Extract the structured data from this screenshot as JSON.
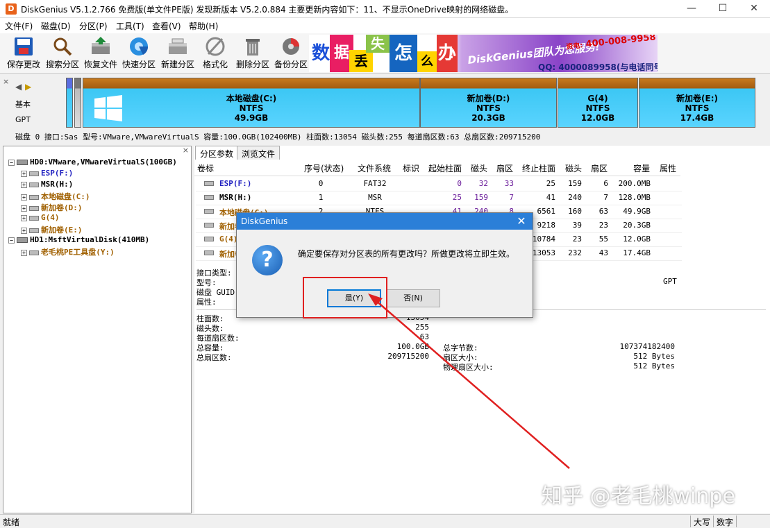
{
  "window": {
    "app_icon": "D",
    "title": "DiskGenius V5.1.2.766 免费版(单文件PE版)  发现新版本 V5.2.0.884 主要更新内容如下：11、不显示OneDrive映射的网络磁盘。",
    "minimize": "—",
    "maximize": "☐",
    "close": "✕"
  },
  "menu": [
    "文件(F)",
    "磁盘(D)",
    "分区(P)",
    "工具(T)",
    "查看(V)",
    "帮助(H)"
  ],
  "toolbar": [
    {
      "label": "保存更改",
      "icon": "save-icon"
    },
    {
      "label": "搜索分区",
      "icon": "magnifier-icon"
    },
    {
      "label": "恢复文件",
      "icon": "recover-icon"
    },
    {
      "label": "快速分区",
      "icon": "quick-partition-icon"
    },
    {
      "label": "新建分区",
      "icon": "new-partition-icon"
    },
    {
      "label": "格式化",
      "icon": "format-icon"
    },
    {
      "label": "删除分区",
      "icon": "trash-icon"
    },
    {
      "label": "备份分区",
      "icon": "backup-icon"
    }
  ],
  "banner": {
    "chars": [
      "数",
      "据",
      "丢",
      "失",
      "怎",
      "么",
      "办",
      "!"
    ],
    "slogan": "DiskGenius团队为您服务!",
    "phone": "400-008-9958",
    "phone_prefix": "资电:",
    "qq": "QQ: 4000089958(与电话同号)"
  },
  "disk_nav": {
    "close": "×",
    "basic": "基本",
    "gpt": "GPT"
  },
  "partitions": [
    {
      "name": "本地磁盘(C:)",
      "fs": "NTFS",
      "size": "49.9GB"
    },
    {
      "name": "新加卷(D:)",
      "fs": "NTFS",
      "size": "20.3GB"
    },
    {
      "name": "G(4)",
      "fs": "NTFS",
      "size": "12.0GB"
    },
    {
      "name": "新加卷(E:)",
      "fs": "NTFS",
      "size": "17.4GB"
    }
  ],
  "disk_info": "磁盘 0 接口:Sas  型号:VMware,VMwareVirtualS  容量:100.0GB(102400MB)  柱面数:13054  磁头数:255  每道扇区数:63  总扇区数:209715200",
  "tree": [
    {
      "label": "HD0:VMware,VMwareVirtualS(100GB)",
      "level": 0,
      "color": "#000000"
    },
    {
      "label": "ESP(F:)",
      "level": 1,
      "color": "#2020c0"
    },
    {
      "label": "MSR(H:)",
      "level": 1,
      "color": "#000000"
    },
    {
      "label": "本地磁盘(C:)",
      "level": 1,
      "color": "#a06000"
    },
    {
      "label": "新加卷(D:)",
      "level": 1,
      "color": "#a06000"
    },
    {
      "label": "G(4)",
      "level": 1,
      "color": "#a06000"
    },
    {
      "label": "新加卷(E:)",
      "level": 1,
      "color": "#a06000"
    },
    {
      "label": "HD1:MsftVirtualDisk(410MB)",
      "level": 0,
      "color": "#000000"
    },
    {
      "label": "老毛桃PE工具盘(Y:)",
      "level": 1,
      "color": "#a06000"
    }
  ],
  "tabs": [
    "分区参数",
    "浏览文件"
  ],
  "table": {
    "headers": [
      "卷标",
      "序号(状态)",
      "文件系统",
      "标识",
      "起始柱面",
      "磁头",
      "扇区",
      "终止柱面",
      "磁头",
      "扇区",
      "容量",
      "属性"
    ],
    "rows": [
      {
        "label": "ESP(F:)",
        "index": "0",
        "fs": "FAT32",
        "sc": "0",
        "sh": "32",
        "ss": "33",
        "ec": "25",
        "eh": "159",
        "es": "6",
        "size": "200.0MB",
        "color": "#2020c0"
      },
      {
        "label": "MSR(H:)",
        "index": "1",
        "fs": "MSR",
        "sc": "25",
        "sh": "159",
        "ss": "7",
        "ec": "41",
        "eh": "240",
        "es": "7",
        "size": "128.0MB",
        "color": "#000000"
      },
      {
        "label": "本地磁盘(C:)",
        "index": "2",
        "fs": "NTFS",
        "sc": "41",
        "sh": "240",
        "ss": "8",
        "ec": "6561",
        "eh": "160",
        "es": "63",
        "size": "49.9GB",
        "color": "#a06000"
      },
      {
        "label": "新加卷(D:)",
        "index": "",
        "fs": "",
        "sc": "",
        "sh": "",
        "ss": "",
        "ec": "9218",
        "eh": "39",
        "es": "23",
        "size": "20.3GB",
        "color": "#a06000"
      },
      {
        "label": "G(4)",
        "index": "",
        "fs": "",
        "sc": "",
        "sh": "",
        "ss": "",
        "ec": "10784",
        "eh": "23",
        "es": "55",
        "size": "12.0GB",
        "color": "#a06000"
      },
      {
        "label": "新加卷(E:)",
        "index": "",
        "fs": "",
        "sc": "",
        "sh": "",
        "ss": "",
        "ec": "13053",
        "eh": "232",
        "es": "43",
        "size": "17.4GB",
        "color": "#a06000"
      }
    ]
  },
  "details": {
    "interface_label": "接口类型:",
    "model_label": "型号:",
    "guid_label": "磁盘 GUID:",
    "attr_label": "属性:",
    "gpt": "GPT",
    "cyl_label": "柱面数:",
    "cyl": "13054",
    "heads_label": "磁头数:",
    "heads": "255",
    "spt_label": "每道扇区数:",
    "spt": "63",
    "cap_label": "总容量:",
    "cap": "100.0GB",
    "sectors_label": "总扇区数:",
    "sectors": "209715200",
    "bytes_label": "总字节数:",
    "bytes": "107374182400",
    "ss_label": "扇区大小:",
    "ss": "512 Bytes",
    "pss_label": "物理扇区大小:",
    "pss": "512 Bytes"
  },
  "dialog": {
    "title": "DiskGenius",
    "close": "✕",
    "icon": "?",
    "message": "确定要保存对分区表的所有更改吗？所做更改将立即生效。",
    "yes": "是(Y)",
    "no": "否(N)"
  },
  "watermark": "知乎 @老毛桃winpe",
  "status": {
    "text": "就绪",
    "caps": "大写",
    "num": "数字"
  },
  "colors": {
    "accent": "#2b7fd8",
    "highlight": "#e02020",
    "partition_blue": "#5ad4ff",
    "partition_header": "#a45d10"
  }
}
